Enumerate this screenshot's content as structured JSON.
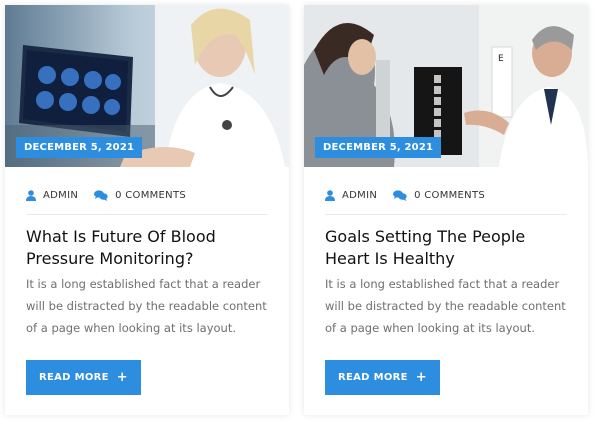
{
  "colors": {
    "accent": "#2d8ddf",
    "title": "#111111",
    "excerpt": "#6f6f6f"
  },
  "posts": [
    {
      "date": "DECEMBER 5, 2021",
      "author": "ADMIN",
      "author_icon": "user-icon",
      "comments": "0 COMMENTS",
      "comments_icon": "comments-icon",
      "title_line1": "What Is Future Of Blood",
      "title_line2": "Pressure Monitoring?",
      "excerpt_line1": "It is a long established fact that a reader",
      "excerpt_line2": "will be distracted by the readable content",
      "excerpt_line3": "of a page when looking at its layout.",
      "button_label": "READ MORE",
      "button_icon": "plus-icon"
    },
    {
      "date": "DECEMBER 5, 2021",
      "author": "ADMIN",
      "author_icon": "user-icon",
      "comments": "0 COMMENTS",
      "comments_icon": "comments-icon",
      "title_line1": "Goals Setting The People",
      "title_line2": "Heart Is Healthy",
      "excerpt_line1": "It is a long established fact that a reader",
      "excerpt_line2": "will be distracted by the readable content",
      "excerpt_line3": "of a page when looking at its layout.",
      "button_label": "READ MORE",
      "button_icon": "plus-icon"
    }
  ]
}
